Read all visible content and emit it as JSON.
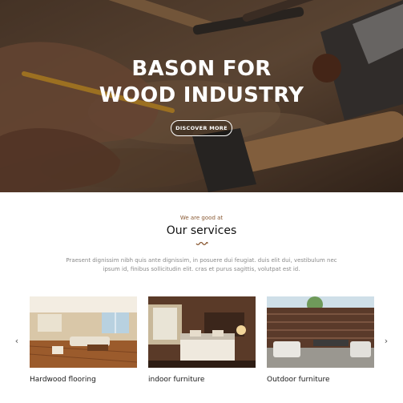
{
  "hero": {
    "title_line1": "BASON FOR",
    "title_line2": "WOOD INDUSTRY",
    "button_label": "DISCOVER MORE"
  },
  "services": {
    "kicker": "We are good at",
    "title": "Our services",
    "description": "Praesent dignissim nibh quis ante dignissim, in posuere dui feugiat. duis elit dui, vestibulum nec ipsum id, finibus sollicitudin elit. cras et purus sagittis, volutpat est id.",
    "prev_icon": "chevron-left-icon",
    "next_icon": "chevron-right-icon",
    "cards": [
      {
        "label": "Hardwood flooring"
      },
      {
        "label": "indoor furniture"
      },
      {
        "label": "Outdoor furniture"
      }
    ]
  },
  "colors": {
    "accent": "#8a5a34",
    "hero_overlay": "#2b1f16"
  }
}
